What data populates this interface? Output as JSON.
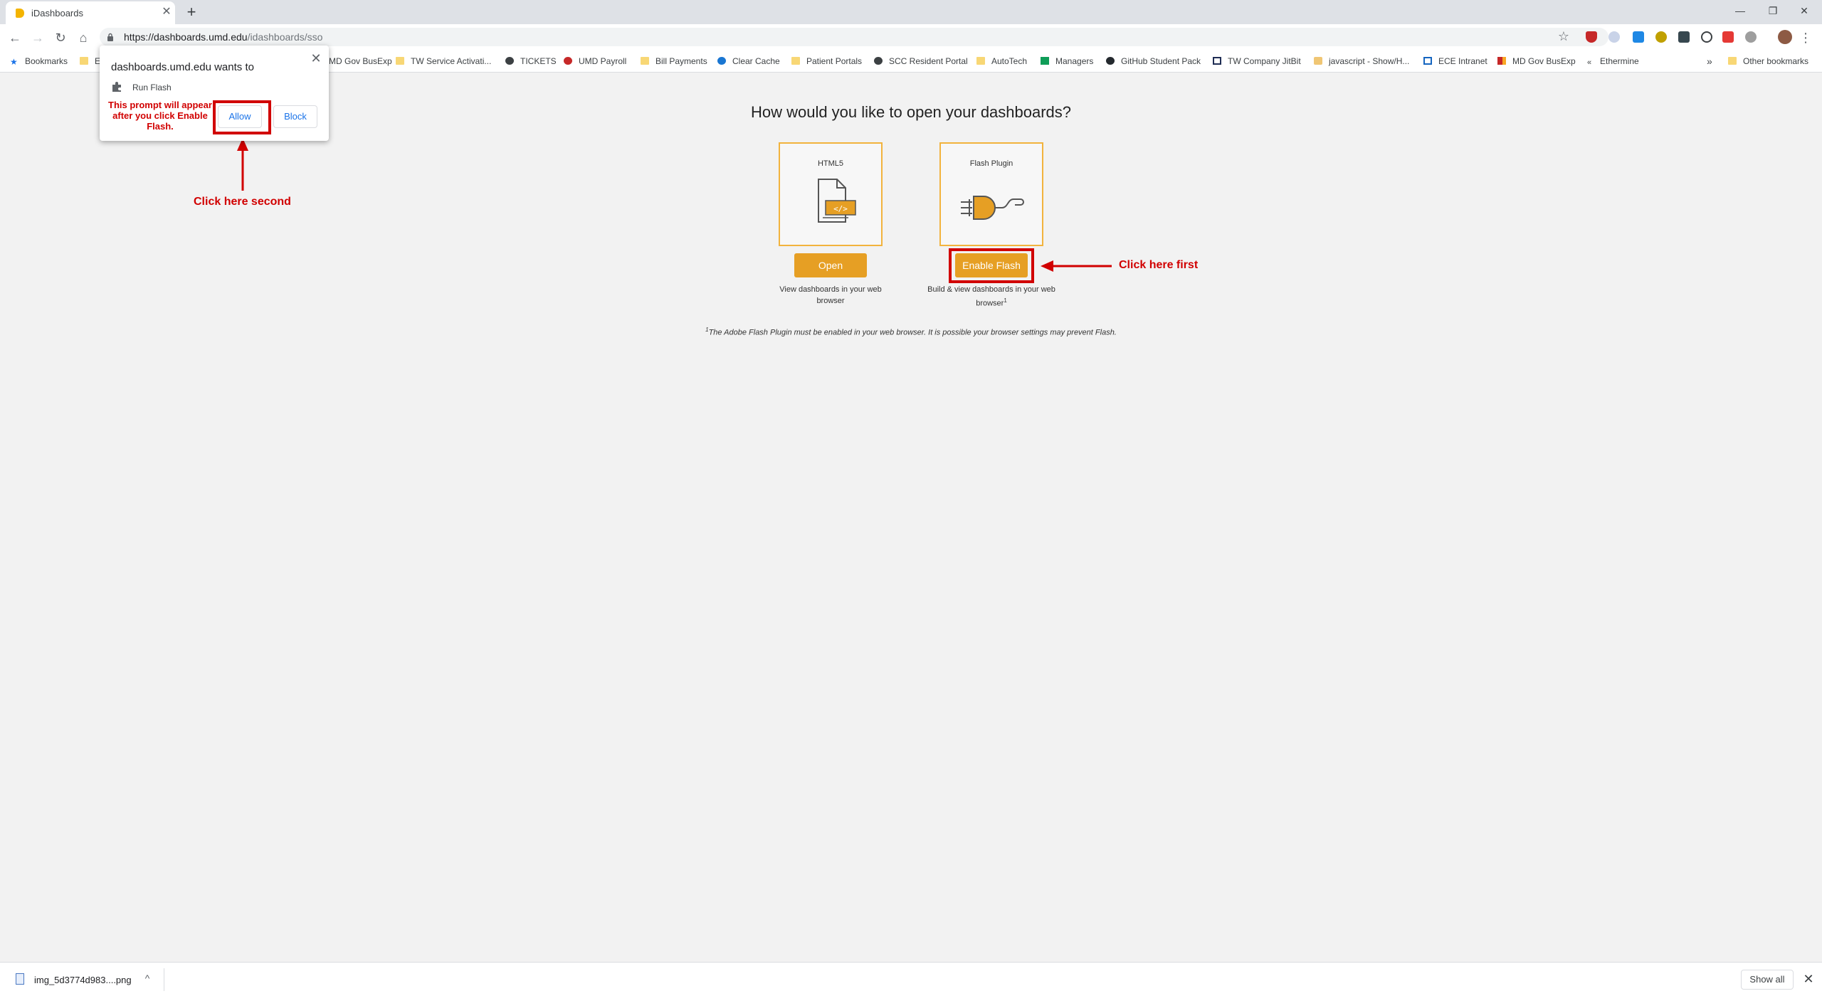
{
  "tab": {
    "title": "iDashboards",
    "close": "✕",
    "new_tab": "+"
  },
  "window_controls": {
    "minimize": "—",
    "restore": "❐",
    "close": "✕"
  },
  "toolbar": {
    "back": "←",
    "forward": "→",
    "reload": "↻",
    "home": "⌂",
    "url_host": "https://dashboards.umd.edu",
    "url_path": "/idashboards/sso",
    "star": "☆",
    "menu": "⋮"
  },
  "bookmarks": {
    "items": [
      "Bookmarks",
      "E",
      "MD Gov BusExp",
      "TW Service Activati...",
      "TICKETS",
      "UMD Payroll",
      "Bill Payments",
      "Clear Cache",
      "Patient Portals",
      "SCC Resident Portal",
      "AutoTech",
      "Managers",
      "GitHub Student Pack",
      "TW Company JitBit",
      "javascript - Show/H...",
      "ECE Intranet",
      "MD Gov BusExp",
      "Ethermine"
    ],
    "overflow": "»",
    "other": "Other bookmarks"
  },
  "page": {
    "heading": "How would you like to open your dashboards?",
    "html5": {
      "title": "HTML5",
      "button": "Open",
      "desc": "View dashboards in your web browser"
    },
    "flash": {
      "title": "Flash Plugin",
      "button": "Enable Flash",
      "desc": "Build & view dashboards in your web browser",
      "desc_sup": "1"
    },
    "footnote_sup": "1",
    "footnote": "The Adobe Flash Plugin must be enabled in your web browser. It is possible your browser settings may prevent Flash."
  },
  "popup": {
    "title": "dashboards.umd.edu wants to",
    "close": "✕",
    "permission": "Run Flash",
    "note": "This prompt will appear after you click Enable Flash.",
    "allow": "Allow",
    "block": "Block"
  },
  "annotations": {
    "second": "Click here second",
    "first": "Click here first"
  },
  "download": {
    "filename": "img_5d3774d983....png",
    "chevron": "^",
    "show_all": "Show all",
    "close": "✕"
  },
  "colors": {
    "accent": "#e69f24",
    "card_border": "#f2b33d",
    "annotation": "#d10000",
    "link": "#1a73e8"
  }
}
